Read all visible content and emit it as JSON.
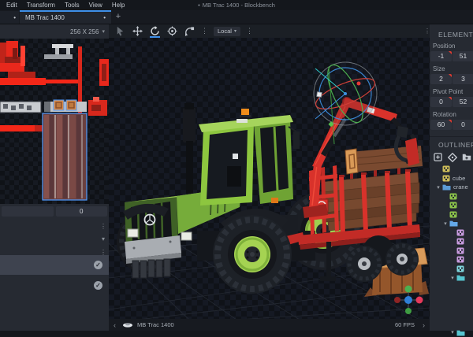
{
  "window": {
    "unsaved_indicator": "•",
    "title": "MB Trac 1400 - Blockbench",
    "menus": [
      "Edit",
      "Transform",
      "Tools",
      "View",
      "Help"
    ]
  },
  "tabs": {
    "active_tab": "MB Trac 1400",
    "active_unsaved_dot": "•",
    "partial_tab_dot": "•",
    "add_button": "+"
  },
  "uv_panel": {
    "texture_size": "256 X 256",
    "size_dropdown_chevron": "▾",
    "slider_left_value": "",
    "slider_right_value": "0",
    "menu_dots": "⋮",
    "section_chevron": "▾",
    "check_glyph": "✓"
  },
  "toolbar": {
    "space_label": "Local",
    "space_caret": "▾",
    "menu_dots": "⋮",
    "active_tool": "rotate-tool"
  },
  "viewport": {
    "prev_chevron": "‹",
    "next_chevron": "›",
    "model_name": "MB Trac 1400",
    "fps": "60 FPS"
  },
  "element_panel": {
    "title": "ELEMENT",
    "fields": [
      {
        "label": "Position",
        "values": [
          "-1",
          "51"
        ]
      },
      {
        "label": "Size",
        "values": [
          "2",
          "3"
        ]
      },
      {
        "label": "Pivot Point",
        "values": [
          "0",
          "52"
        ]
      },
      {
        "label": "Rotation",
        "values": [
          "60",
          "0"
        ]
      }
    ]
  },
  "outliner": {
    "title": "OUTLINER",
    "expand_chevron": "▾",
    "items": [
      {
        "icon": "cube",
        "color": "#cdbd5a",
        "label": "",
        "indent": 0,
        "expanded": false
      },
      {
        "icon": "cube",
        "color": "#cdbd5a",
        "label": "cube",
        "indent": 0,
        "expanded": false
      },
      {
        "icon": "folder",
        "color": "#5b9bd5",
        "label": "crane",
        "indent": 0,
        "expanded": true
      },
      {
        "icon": "cube",
        "color": "#8bc34a",
        "label": "",
        "indent": 1,
        "expanded": false
      },
      {
        "icon": "cube",
        "color": "#8bc34a",
        "label": "",
        "indent": 1,
        "expanded": false
      },
      {
        "icon": "cube",
        "color": "#8bc34a",
        "label": "",
        "indent": 1,
        "expanded": false
      },
      {
        "icon": "folder",
        "color": "#64a8e8",
        "label": "",
        "indent": 1,
        "expanded": true
      },
      {
        "icon": "cube",
        "color": "#c79bde",
        "label": "",
        "indent": 2,
        "expanded": false
      },
      {
        "icon": "cube",
        "color": "#c79bde",
        "label": "",
        "indent": 2,
        "expanded": false
      },
      {
        "icon": "cube",
        "color": "#c79bde",
        "label": "",
        "indent": 2,
        "expanded": false
      },
      {
        "icon": "cube",
        "color": "#c79bde",
        "label": "",
        "indent": 2,
        "expanded": false
      },
      {
        "icon": "cube",
        "color": "#7fd4dc",
        "label": "",
        "indent": 2,
        "expanded": false
      },
      {
        "icon": "folder",
        "color": "#56c5d0",
        "label": "",
        "indent": 2,
        "expanded": true
      },
      {
        "icon": "folder",
        "color": "#56c5d0",
        "label": "",
        "indent": 2,
        "expanded": true,
        "gap_before": 58
      }
    ]
  },
  "colors": {
    "accent_blue": "#3e8fe8",
    "selection_blue": "#4f9bff",
    "tractor_green": "#8dc63f",
    "trailer_red": "#d8322b",
    "log_brown": "#7a4a30",
    "axis_x_red": "#e03c32",
    "axis_y_green": "#4caf50",
    "axis_z_blue": "#3d8fe0"
  }
}
